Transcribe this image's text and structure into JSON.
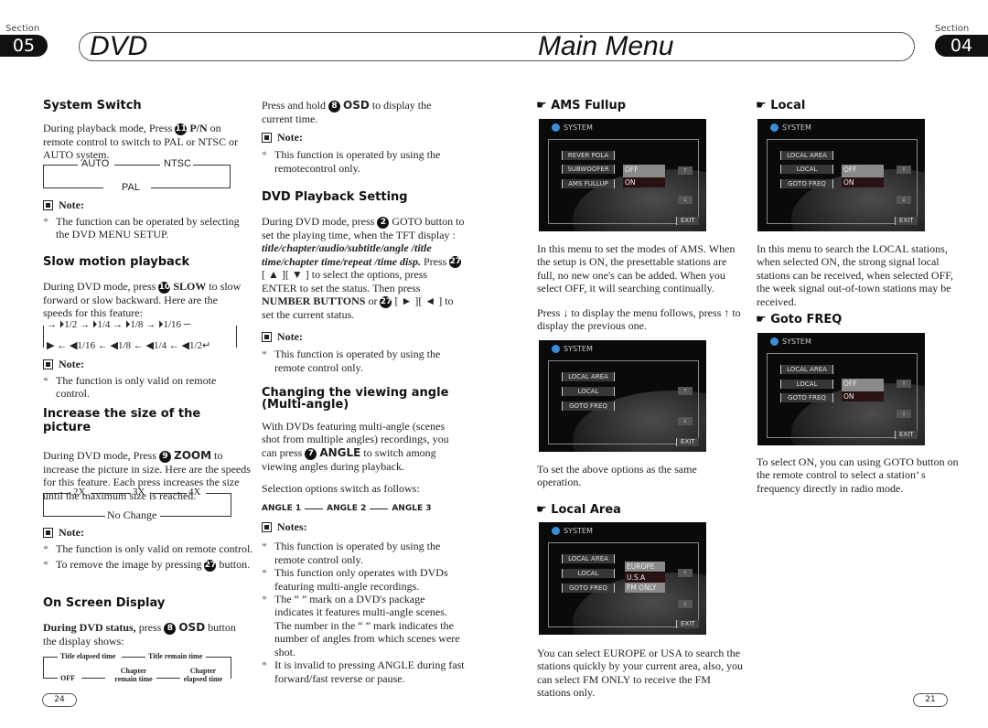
{
  "header": {
    "left": {
      "section_label": "Section",
      "section_number": "05",
      "title": "DVD"
    },
    "center_title": "Main Menu",
    "right": {
      "section_label": "Section",
      "section_number": "04"
    }
  },
  "system_switch": {
    "heading": "System Switch",
    "body_pre": "During playback mode, Press",
    "button_num": "11",
    "button_name": "P/N",
    "body_post": "on remote control to switch to PAL or NTSC or AUTO system.",
    "flow": [
      "AUTO",
      "NTSC",
      "PAL"
    ],
    "note_label": "Note:",
    "note": "The function can be operated by selecting the DVD MENU SETUP."
  },
  "slow_motion": {
    "heading": "Slow motion playback",
    "body_pre": "During DVD mode, press",
    "button_num": "10",
    "button_name": "SLOW",
    "body_post": "to slow forward or slow backward. Here are the speeds for this feature:",
    "forward": [
      "1/2",
      "1/4",
      "1/8",
      "1/16"
    ],
    "backward": [
      "1/16",
      "1/8",
      "1/4",
      "1/2"
    ],
    "note_label": "Note:",
    "note": "The function is only valid on remote control."
  },
  "zoom": {
    "heading": "Increase the size of the picture",
    "body_pre": "During DVD mode, Press",
    "button_num": "9",
    "button_name": "ZOOM",
    "body_post": "to increase the picture in size. Here are the speeds for this feature. Each press increases the size until the maximum size is reached.",
    "flow": [
      "2X",
      "3X",
      "4X",
      "No Change"
    ],
    "note_label": "Note:",
    "notes": [
      "The function is only valid on remote control.",
      "To remove the image by pressing",
      "button."
    ],
    "notes_button_num": "27"
  },
  "osd": {
    "heading": "On Screen Display",
    "body_bold": "During DVD status,",
    "body_pre": "press",
    "button_num": "8",
    "button_name": "OSD",
    "body_post": "button the display shows:",
    "flow": [
      "Title elapsed time",
      "Title remain time",
      "Chapter elapsed time",
      "Chapter remain time",
      "OFF"
    ]
  },
  "col2": {
    "osd_hold_pre": "Press and hold",
    "osd_hold_num": "8",
    "osd_hold_btn": "OSD",
    "osd_hold_post": "to display the current time.",
    "note_label": "Note:",
    "note": "This function is operated by using the remotecontrol only.",
    "playback": {
      "heading": "DVD Playback Setting",
      "p1_pre": "During DVD mode, press",
      "p1_num": "2",
      "p1_post": "GOTO button to set the playing time, when the TFT display :",
      "p1_italic": "title/chapter/audio/subtitle/angle /title time/chapter time/repeat /time disp.",
      "p2_pre": "Press",
      "p2_num": "27",
      "p2_mid": "[ ▲ ][ ▼ ] to select the options, press ENTER to set the status. Then press",
      "p2_bold": "NUMBER BUTTONS",
      "p2_or": "or",
      "p2_post": "[ ► ][ ◄ ] to set the current status.",
      "note_label": "Note:",
      "note": "This function is operated by using the remote control only."
    },
    "angle": {
      "heading": "Changing the viewing angle (Multi-angle)",
      "p1_pre": "With DVDs featuring multi-angle (scenes shot from multiple angles) recordings, you can press",
      "p1_num": "7",
      "p1_btn": "ANGLE",
      "p1_post": "to switch among viewing angles during playback.",
      "p2": "Selection options switch as follows:",
      "flow": [
        "ANGLE 1",
        "ANGLE 2",
        "ANGLE 3"
      ],
      "notes_label": "Notes:",
      "notes": [
        "This function is operated by using the remote control only.",
        "This function only operates with DVDs featuring multi-angle recordings.",
        "The “ ” mark on a DVD's package indicates it features multi-angle scenes. The number in the “ ” mark indicates the number of angles from which scenes were shot.",
        "It is invalid to pressing ANGLE during fast forward/fast reverse or pause."
      ]
    }
  },
  "col3": {
    "ams": {
      "heading": "AMS Fullup",
      "screen": {
        "title": "SYSTEM",
        "items": [
          "REVER POLA",
          "SUBWOOFER",
          "AMS FULLUP"
        ],
        "options": [
          "OFF",
          "ON"
        ],
        "exit": "EXIT"
      },
      "desc": "In this menu to set the modes of AMS. When the setup is ON, the presettable stations are full, no new one's can be added. When you select OFF, it will searching continually.",
      "press_pre": "Press",
      "press_mid": "to display the menu follows, press",
      "press_post": "to display the previous one."
    },
    "second_screen": {
      "title": "SYSTEM",
      "items": [
        "LOCAL AREA",
        "LOCAL",
        "GOTO FREQ"
      ],
      "exit": "EXIT"
    },
    "second_desc": "To set the above options as the same operation.",
    "local_area": {
      "heading": "Local Area",
      "screen": {
        "title": "SYSTEM",
        "items": [
          "LOCAL AREA",
          "LOCAL",
          "GOTO FREQ"
        ],
        "options": [
          "EUROPE",
          "U.S.A",
          "FM ONLY"
        ],
        "exit": "EXIT"
      },
      "desc": "You can select EUROPE or USA to search the stations quickly by your current area, also, you can select FM ONLY to receive the FM stations only."
    }
  },
  "col4": {
    "local": {
      "heading": "Local",
      "screen": {
        "title": "SYSTEM",
        "items": [
          "LOCAL AREA",
          "LOCAL",
          "GOTO FREQ"
        ],
        "options": [
          "OFF",
          "ON"
        ],
        "exit": "EXIT"
      },
      "desc": "In this menu to search the LOCAL stations, when selected ON, the strong signal local stations can be received, when selected OFF, the week signal out-of-town stations may be received."
    },
    "goto": {
      "heading": "Goto FREQ",
      "screen": {
        "title": "SYSTEM",
        "items": [
          "LOCAL AREA",
          "LOCAL",
          "GOTO FREQ"
        ],
        "options": [
          "OFF",
          "ON"
        ],
        "exit": "EXIT"
      },
      "desc": "To select ON, you can using GOTO button on the remote control to select a station’ s frequency directly in radio mode."
    }
  },
  "footer": {
    "left_page": "24",
    "right_page": "21"
  }
}
